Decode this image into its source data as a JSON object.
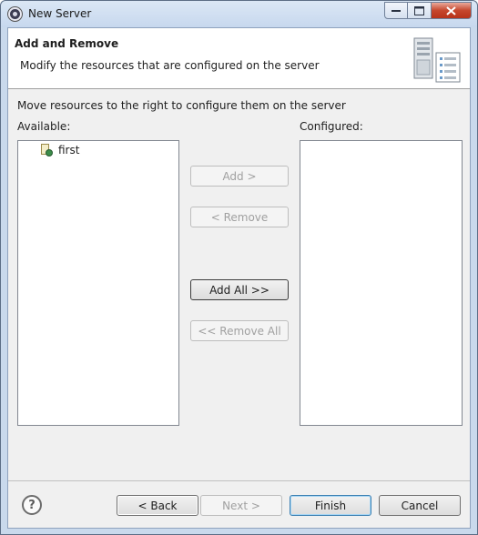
{
  "window": {
    "title": "New Server"
  },
  "banner": {
    "title": "Add and Remove",
    "subtitle": "Modify the resources that are configured on the server",
    "icon": "server-icon"
  },
  "main": {
    "message": "Move resources to the right to configure them on the server",
    "available_label": "Available:",
    "configured_label": "Configured:",
    "available_items": [
      {
        "label": "first",
        "icon": "web-project-icon"
      }
    ],
    "configured_items": []
  },
  "buttons": {
    "add": "Add >",
    "remove": "< Remove",
    "add_all": "Add All >>",
    "remove_all": "<< Remove All",
    "back": "< Back",
    "next": "Next >",
    "finish": "Finish",
    "cancel": "Cancel"
  },
  "help": {
    "glyph": "?"
  }
}
